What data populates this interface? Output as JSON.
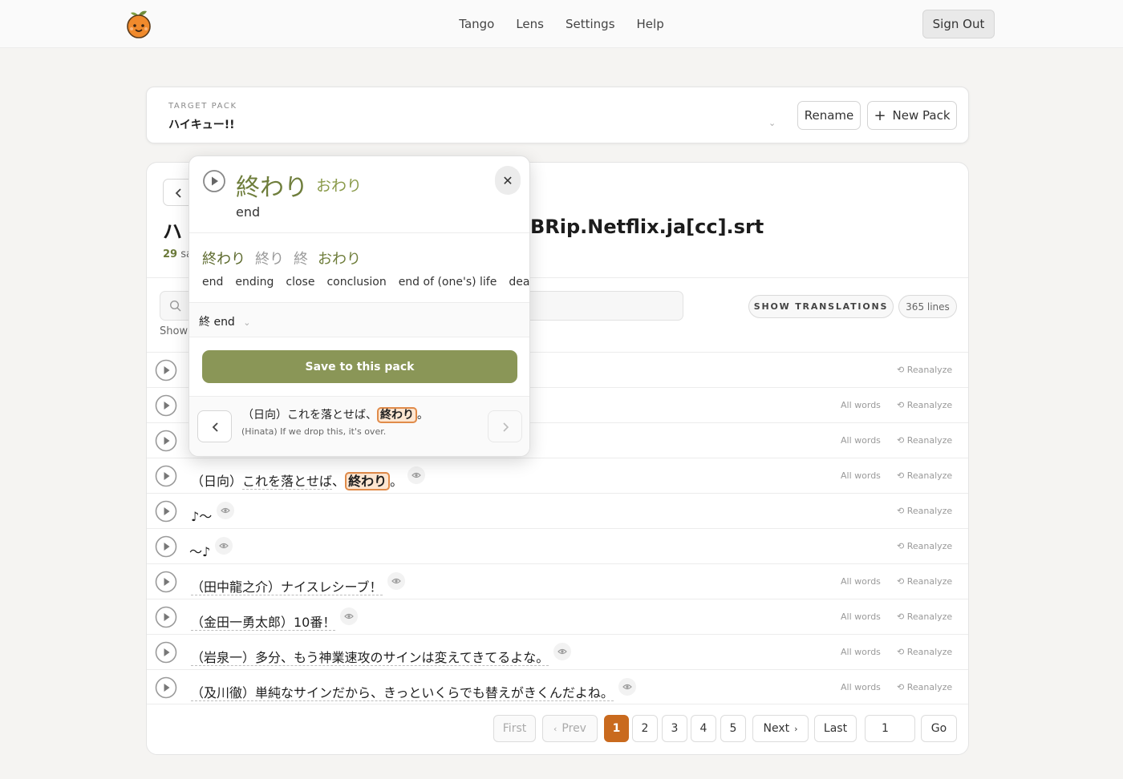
{
  "nav": {
    "items": [
      "Tango",
      "Lens",
      "Settings",
      "Help"
    ],
    "sign_out": "Sign Out"
  },
  "pack": {
    "label": "TARGET PACK",
    "value": "ハイキュー!!",
    "rename": "Rename",
    "new_pack": "New Pack"
  },
  "file": {
    "title_start": "ハ",
    "title_end": "BRip.Netflix.ja[cc].srt",
    "saved_count": "29",
    "saved_rest": " sa"
  },
  "toolbar": {
    "search_placeholder": "",
    "showing": "Showi",
    "show_translations": "SHOW TRANSLATIONS",
    "lines": "365 lines"
  },
  "rows": [
    {
      "text": "",
      "allwords": "",
      "reanalyze": "Reanalyze"
    },
    {
      "text": "",
      "allwords": "All words",
      "reanalyze": "Reanalyze"
    },
    {
      "text": "",
      "allwords": "All words",
      "reanalyze": "Reanalyze"
    },
    {
      "pre": "（日向）",
      "u1": "これを",
      "u2": "落とせば",
      "mid": "、",
      "hl": "終わり",
      "post": "。",
      "allwords": "All words",
      "reanalyze": "Reanalyze"
    },
    {
      "text": "♪～",
      "allwords": "",
      "reanalyze": "Reanalyze"
    },
    {
      "text": "～♪",
      "allwords": "",
      "reanalyze": "Reanalyze"
    },
    {
      "text": "（田中龍之介）ナイスレシーブ！",
      "allwords": "All words",
      "reanalyze": "Reanalyze"
    },
    {
      "text": "（金田一勇太郎）10番！",
      "allwords": "All words",
      "reanalyze": "Reanalyze"
    },
    {
      "text": "（岩泉一）多分、もう神業速攻のサインは変えてきてるよな。",
      "allwords": "All words",
      "reanalyze": "Reanalyze"
    },
    {
      "text": "（及川徹）単純なサインだから、きっといくらでも替えがきくんだよね。",
      "allwords": "All words",
      "reanalyze": "Reanalyze"
    }
  ],
  "pagination": {
    "first": "First",
    "prev": "Prev",
    "pages": [
      "1",
      "2",
      "3",
      "4",
      "5"
    ],
    "next": "Next",
    "last": "Last",
    "input": "1",
    "go": "Go"
  },
  "popup": {
    "word": "終わり",
    "reading": "おわり",
    "meaning": "end",
    "forms": [
      "終わり",
      "終り",
      "終",
      "おわり"
    ],
    "senses": [
      "end",
      "ending",
      "close",
      "conclusion",
      "end of (one's) life",
      "death"
    ],
    "kanji": "終 end",
    "save": "Save to this pack",
    "context_jp_pre": "（日向）これを落とせば、",
    "context_jp_hl": "終わり",
    "context_jp_post": "。",
    "context_en": "(Hinata) If we drop this, it's over."
  },
  "colors": {
    "accent": "#8a9657",
    "page_active": "#c96a1e",
    "highlight_border": "#e08b4a"
  }
}
